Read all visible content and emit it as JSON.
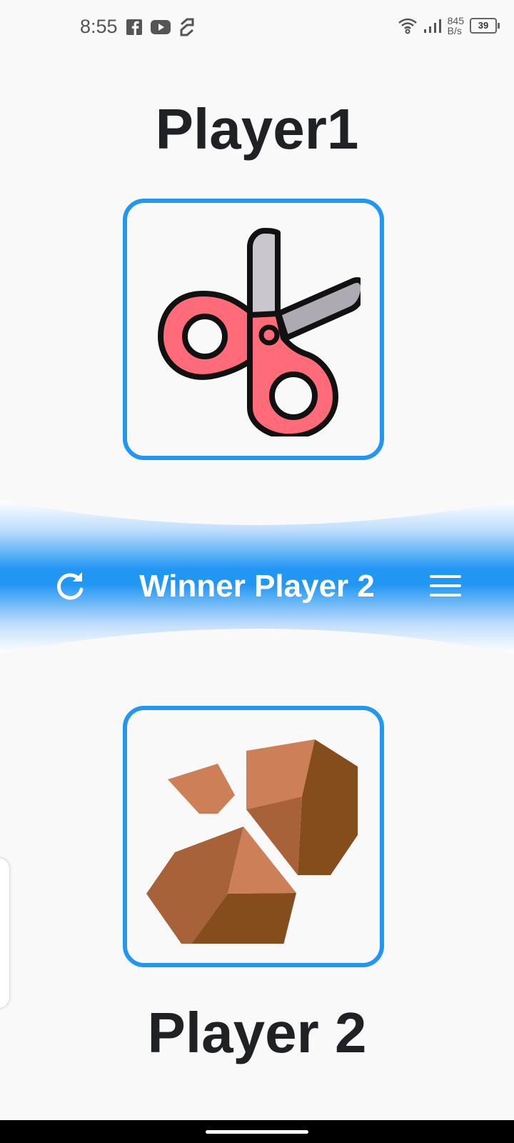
{
  "status_bar": {
    "time": "8:55",
    "net_speed_value": "845",
    "net_speed_unit": "B/s",
    "battery": "39"
  },
  "player1": {
    "name": "Player1",
    "choice": "scissors-icon"
  },
  "player2": {
    "name": "Player 2",
    "choice": "rock-icon"
  },
  "result": {
    "text": "Winner Player 2"
  },
  "colors": {
    "accent": "#2196f3",
    "title": "#202124",
    "background": "#f9f9f9",
    "scissors_red": "#ff6b78",
    "rock_brown": "#a8623a"
  }
}
